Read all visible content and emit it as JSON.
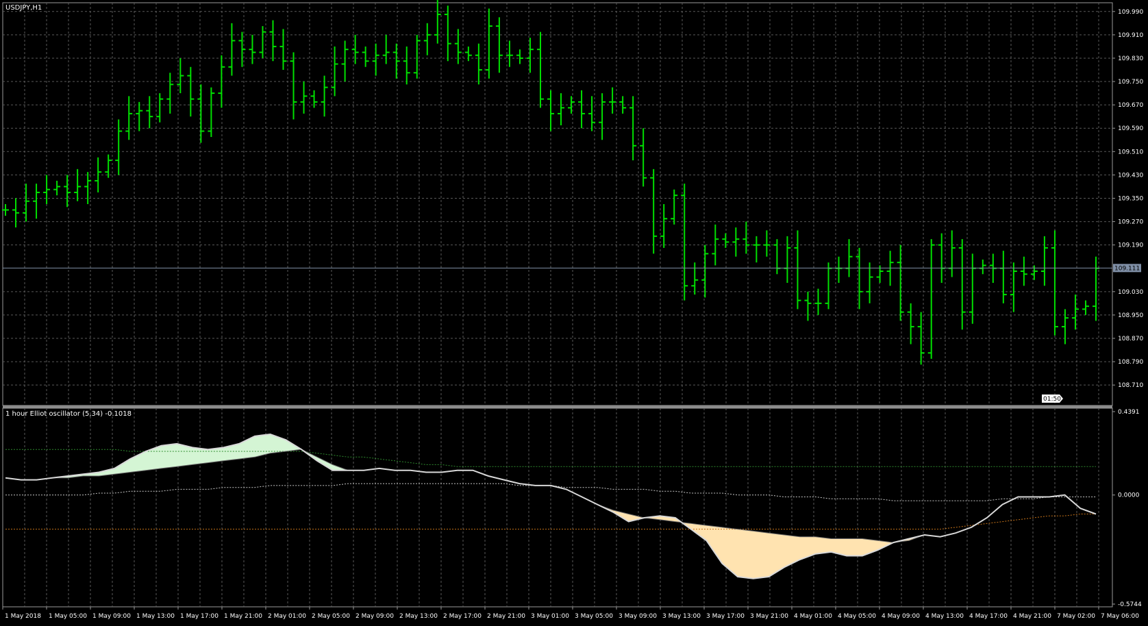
{
  "chart_data": [
    {
      "type": "ohlc",
      "title": "USDJPY,H1",
      "symbol": "USDJPY",
      "timeframe": "H1",
      "ylim": [
        108.64,
        110.02
      ],
      "y_ticks": [
        "109.990",
        "109.910",
        "109.830",
        "109.750",
        "109.670",
        "109.590",
        "109.510",
        "109.430",
        "109.350",
        "109.270",
        "109.190",
        "109.030",
        "108.950",
        "108.870",
        "108.790",
        "108.710"
      ],
      "current_price": "109.111",
      "countdown": "01:50",
      "grid": "dashed",
      "colors": {
        "background": "#000000",
        "bars": "#00e000",
        "grid": "#5a5a5a",
        "axis_text": "#ffffff",
        "price_line": "#7f8fa6"
      },
      "close": [
        109.31,
        109.3,
        109.34,
        109.37,
        109.38,
        109.39,
        109.37,
        109.39,
        109.41,
        109.44,
        109.48,
        109.58,
        109.64,
        109.65,
        109.63,
        109.69,
        109.74,
        109.77,
        109.69,
        109.58,
        109.71,
        109.8,
        109.89,
        109.86,
        109.85,
        109.92,
        109.87,
        109.82,
        109.68,
        109.7,
        109.68,
        109.73,
        109.81,
        109.86,
        109.85,
        109.82,
        109.84,
        109.85,
        109.82,
        109.78,
        109.89,
        109.91,
        109.98,
        109.88,
        109.85,
        109.84,
        109.79,
        109.94,
        109.84,
        109.84,
        109.83,
        109.86,
        109.69,
        109.64,
        109.66,
        109.68,
        109.64,
        109.61,
        109.68,
        109.68,
        109.66,
        109.53,
        109.42,
        109.22,
        109.28,
        109.36,
        109.05,
        109.07,
        109.16,
        109.21,
        109.2,
        109.21,
        109.19,
        109.19,
        109.19,
        109.11,
        109.18,
        109.0,
        108.99,
        108.99,
        109.11,
        109.11,
        109.15,
        109.03,
        109.08,
        109.1,
        109.13,
        108.96,
        108.91,
        108.82,
        109.19,
        109.11,
        109.18,
        108.96,
        109.11,
        109.12,
        109.11,
        109.02,
        109.1,
        109.09,
        109.1,
        109.18,
        108.91,
        108.94,
        108.97,
        108.98,
        109.11
      ]
    },
    {
      "type": "line",
      "title": "1 hour Elliot oscillator (5,34) -0.1018",
      "ylim": [
        -0.5744,
        0.4391
      ],
      "y_ticks": [
        "0.4391",
        "0.0000",
        "-0.5744"
      ],
      "colors": {
        "oscillator": "#d8d8d8",
        "positive_fill": "#d4f5d4",
        "positive_line": "#33cc33",
        "negative_fill": "#ffe3b0",
        "negative_line": "#e69a1a",
        "upper_band": "#2e8b2e",
        "lower_band": "#c8741a",
        "zero_line": "#c8c8c8"
      },
      "series": [
        {
          "values": [
            0.09,
            0.08,
            0.08,
            0.09,
            0.1,
            0.11,
            0.12,
            0.14,
            0.19,
            0.23,
            0.26,
            0.27,
            0.25,
            0.24,
            0.25,
            0.27,
            0.31,
            0.32,
            0.29,
            0.24,
            0.18,
            0.13,
            0.13,
            0.13,
            0.14,
            0.13,
            0.13,
            0.12,
            0.12,
            0.13,
            0.13,
            0.1,
            0.08,
            0.06,
            0.05,
            0.05,
            0.03,
            -0.01,
            -0.05,
            -0.09,
            -0.14,
            -0.12,
            -0.11,
            -0.12,
            -0.18,
            -0.24,
            -0.36,
            -0.43,
            -0.44,
            -0.43,
            -0.38,
            -0.34,
            -0.31,
            -0.3,
            -0.32,
            -0.32,
            -0.29,
            -0.25,
            -0.23,
            -0.21,
            -0.22,
            -0.2,
            -0.17,
            -0.12,
            -0.05,
            -0.01,
            -0.01,
            -0.01,
            0.0,
            -0.07,
            -0.1
          ]
        },
        {
          "values": [
            0.09,
            0.08,
            0.08,
            0.09,
            0.09,
            0.1,
            0.1,
            0.11,
            0.12,
            0.13,
            0.14,
            0.15,
            0.16,
            0.17,
            0.18,
            0.19,
            0.2,
            0.22,
            0.23,
            0.24,
            0.2,
            0.16,
            0.13,
            0.13,
            0.14,
            0.13,
            0.13,
            0.12,
            0.12,
            0.13,
            0.13,
            0.1,
            0.08,
            0.06,
            0.05,
            0.05,
            0.03,
            -0.01,
            -0.05,
            -0.08,
            -0.1,
            -0.12,
            -0.13,
            -0.14,
            -0.15,
            -0.16,
            -0.17,
            -0.18,
            -0.19,
            -0.2,
            -0.21,
            -0.22,
            -0.22,
            -0.23,
            -0.23,
            -0.23,
            -0.24,
            -0.25,
            -0.24,
            -0.21,
            -0.22,
            -0.2,
            -0.17,
            -0.12,
            -0.05,
            -0.01,
            -0.01,
            -0.01,
            0.0,
            -0.07,
            -0.1
          ]
        },
        {
          "values": [
            0.24,
            0.24,
            0.24,
            0.24,
            0.24,
            0.24,
            0.24,
            0.24,
            0.23,
            0.23,
            0.23,
            0.23,
            0.23,
            0.23,
            0.23,
            0.23,
            0.23,
            0.23,
            0.23,
            0.23,
            0.22,
            0.21,
            0.2,
            0.2,
            0.19,
            0.18,
            0.17,
            0.16,
            0.16,
            0.15,
            0.15,
            0.15,
            0.15,
            0.15,
            0.15,
            0.15,
            0.15,
            0.15,
            0.15,
            0.15,
            0.15,
            0.15,
            0.15,
            0.15,
            0.15,
            0.15,
            0.15,
            0.15,
            0.15,
            0.15,
            0.15,
            0.15,
            0.15,
            0.15,
            0.15,
            0.15,
            0.15,
            0.15,
            0.15,
            0.15,
            0.15,
            0.15,
            0.15,
            0.15,
            0.15,
            0.15,
            0.15,
            0.15,
            0.15,
            0.15,
            0.15
          ]
        },
        {
          "values": [
            0.0,
            0.0,
            0.0,
            0.0,
            0.0,
            0.0,
            0.01,
            0.01,
            0.02,
            0.02,
            0.02,
            0.03,
            0.03,
            0.03,
            0.04,
            0.04,
            0.04,
            0.05,
            0.05,
            0.05,
            0.05,
            0.05,
            0.06,
            0.06,
            0.06,
            0.06,
            0.06,
            0.06,
            0.06,
            0.06,
            0.06,
            0.06,
            0.06,
            0.05,
            0.05,
            0.05,
            0.04,
            0.04,
            0.04,
            0.03,
            0.03,
            0.03,
            0.02,
            0.02,
            0.01,
            0.01,
            0.01,
            0.0,
            0.0,
            0.0,
            -0.01,
            -0.01,
            -0.01,
            -0.02,
            -0.02,
            -0.02,
            -0.02,
            -0.03,
            -0.03,
            -0.03,
            -0.03,
            -0.03,
            -0.03,
            -0.03,
            -0.02,
            -0.02,
            -0.02,
            -0.01,
            -0.01,
            -0.01,
            -0.01
          ]
        },
        {
          "values": [
            -0.18,
            -0.18,
            -0.18,
            -0.18,
            -0.18,
            -0.18,
            -0.18,
            -0.18,
            -0.18,
            -0.18,
            -0.18,
            -0.18,
            -0.18,
            -0.18,
            -0.18,
            -0.18,
            -0.18,
            -0.18,
            -0.18,
            -0.18,
            -0.18,
            -0.18,
            -0.18,
            -0.18,
            -0.18,
            -0.18,
            -0.18,
            -0.18,
            -0.18,
            -0.18,
            -0.18,
            -0.18,
            -0.18,
            -0.18,
            -0.18,
            -0.18,
            -0.18,
            -0.18,
            -0.18,
            -0.18,
            -0.18,
            -0.18,
            -0.18,
            -0.18,
            -0.18,
            -0.18,
            -0.18,
            -0.18,
            -0.18,
            -0.18,
            -0.18,
            -0.18,
            -0.18,
            -0.18,
            -0.18,
            -0.18,
            -0.18,
            -0.18,
            -0.18,
            -0.18,
            -0.18,
            -0.17,
            -0.16,
            -0.15,
            -0.14,
            -0.13,
            -0.12,
            -0.11,
            -0.11,
            -0.1,
            -0.1
          ]
        }
      ]
    }
  ],
  "x_axis_labels": [
    "1 May 2018",
    "1 May 05:00",
    "1 May 09:00",
    "1 May 13:00",
    "1 May 17:00",
    "1 May 21:00",
    "2 May 01:00",
    "2 May 05:00",
    "2 May 09:00",
    "2 May 13:00",
    "2 May 17:00",
    "2 May 21:00",
    "3 May 01:00",
    "3 May 05:00",
    "3 May 09:00",
    "3 May 13:00",
    "3 May 17:00",
    "3 May 21:00",
    "4 May 01:00",
    "4 May 05:00",
    "4 May 09:00",
    "4 May 13:00",
    "4 May 17:00",
    "4 May 21:00",
    "7 May 02:00",
    "7 May 06:00"
  ]
}
